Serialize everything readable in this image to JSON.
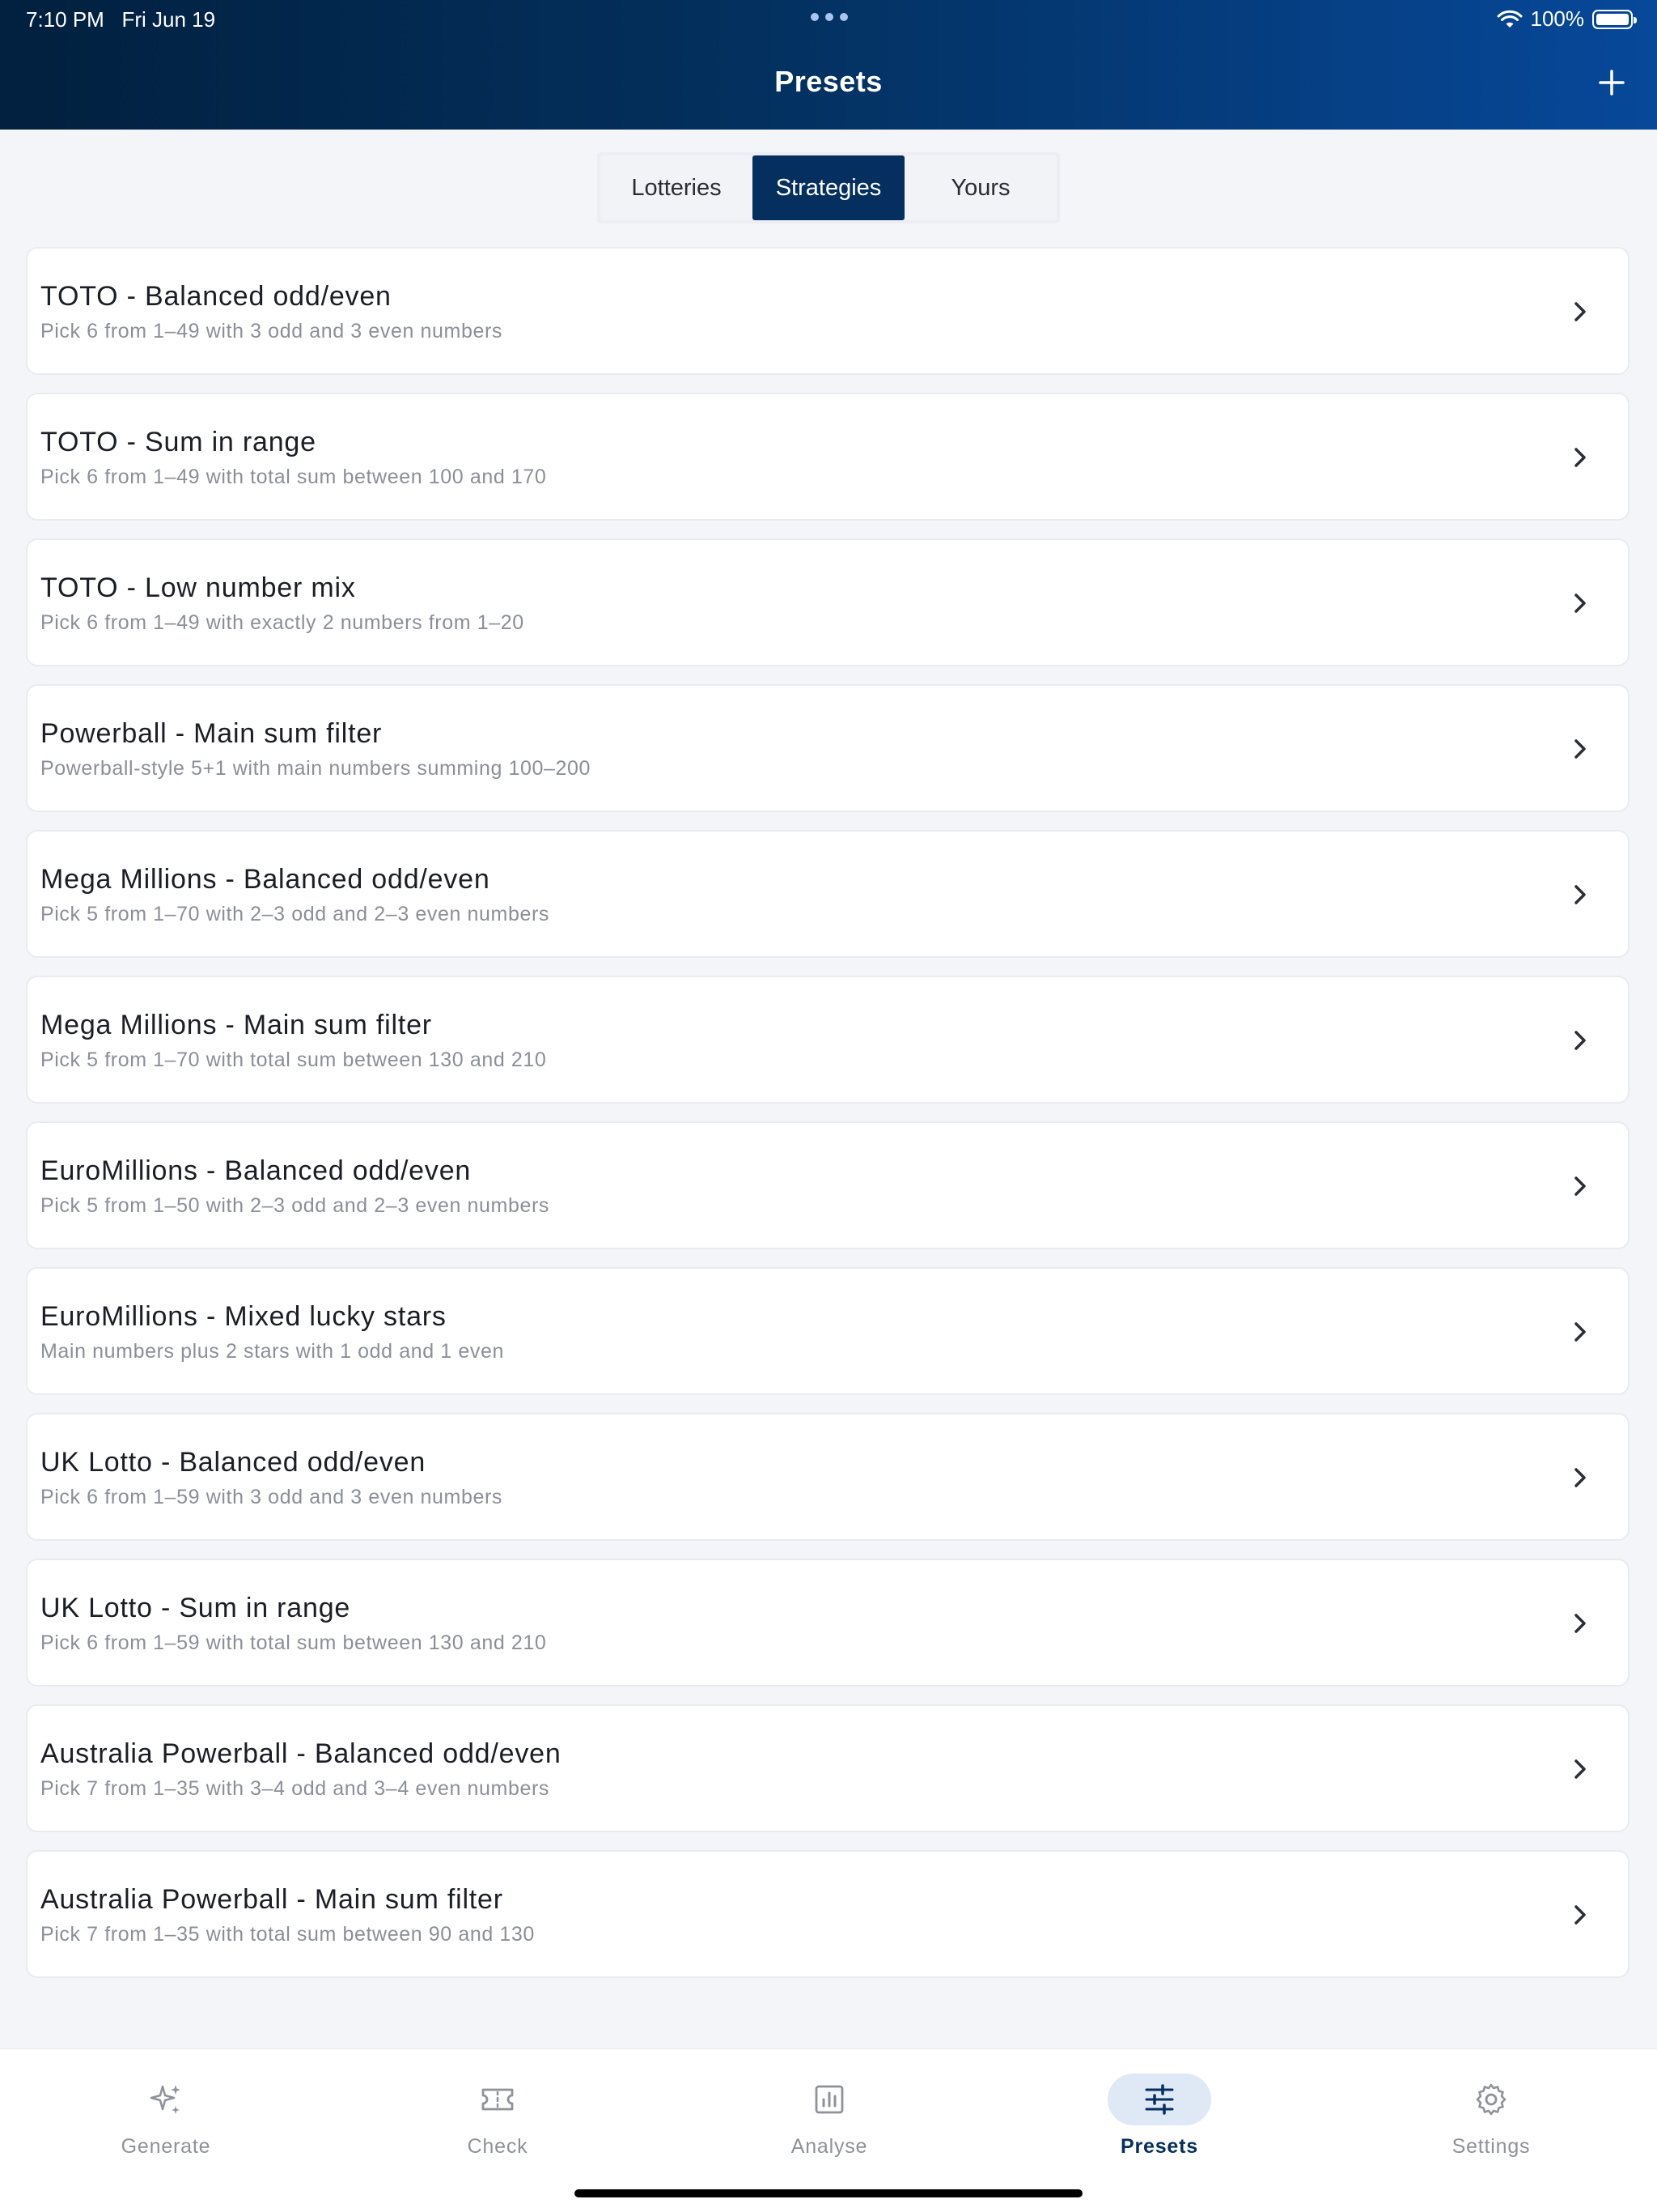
{
  "status": {
    "time": "7:10 PM",
    "date": "Fri Jun 19",
    "battery": "100%"
  },
  "header": {
    "title": "Presets"
  },
  "segments": [
    {
      "label": "Lotteries",
      "active": false
    },
    {
      "label": "Strategies",
      "active": true
    },
    {
      "label": "Yours",
      "active": false
    }
  ],
  "presets": [
    {
      "title": "TOTO - Balanced odd/even",
      "subtitle": "Pick 6 from 1–49 with 3 odd and 3 even numbers"
    },
    {
      "title": "TOTO - Sum in range",
      "subtitle": "Pick 6 from 1–49 with total sum between 100 and 170"
    },
    {
      "title": "TOTO - Low number mix",
      "subtitle": "Pick 6 from 1–49 with exactly 2 numbers from 1–20"
    },
    {
      "title": "Powerball - Main sum filter",
      "subtitle": "Powerball-style 5+1 with main numbers summing 100–200"
    },
    {
      "title": "Mega Millions - Balanced odd/even",
      "subtitle": "Pick 5 from 1–70 with 2–3 odd and 2–3 even numbers"
    },
    {
      "title": "Mega Millions - Main sum filter",
      "subtitle": "Pick 5 from 1–70 with total sum between 130 and 210"
    },
    {
      "title": "EuroMillions - Balanced odd/even",
      "subtitle": "Pick 5 from 1–50 with 2–3 odd and 2–3 even numbers"
    },
    {
      "title": "EuroMillions - Mixed lucky stars",
      "subtitle": "Main numbers plus 2 stars with 1 odd and 1 even"
    },
    {
      "title": "UK Lotto - Balanced odd/even",
      "subtitle": "Pick 6 from 1–59 with 3 odd and 3 even numbers"
    },
    {
      "title": "UK Lotto - Sum in range",
      "subtitle": "Pick 6 from 1–59 with total sum between 130 and 210"
    },
    {
      "title": "Australia Powerball - Balanced odd/even",
      "subtitle": "Pick 7 from 1–35 with 3–4 odd and 3–4 even numbers"
    },
    {
      "title": "Australia Powerball - Main sum filter",
      "subtitle": "Pick 7 from 1–35 with total sum between 90 and 130"
    }
  ],
  "tabs": [
    {
      "label": "Generate",
      "icon": "sparkles-icon",
      "active": false
    },
    {
      "label": "Check",
      "icon": "ticket-icon",
      "active": false
    },
    {
      "label": "Analyse",
      "icon": "bar-chart-icon",
      "active": false
    },
    {
      "label": "Presets",
      "icon": "sliders-icon",
      "active": true
    },
    {
      "label": "Settings",
      "icon": "gear-icon",
      "active": false
    }
  ],
  "colors": {
    "header_start": "#02203f",
    "header_end": "#07489a",
    "accent": "#052f5e",
    "active_pill": "#dfe8f5"
  }
}
